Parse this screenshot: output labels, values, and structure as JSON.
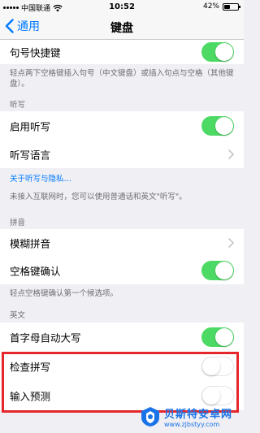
{
  "status_bar": {
    "carrier": "中国联通",
    "time": "10:52",
    "battery": "42%",
    "battery_level": 0.42
  },
  "navbar": {
    "back_label": "通用",
    "title": "键盘"
  },
  "rows": {
    "period_shortcut": {
      "label": "句号快捷键",
      "on": true
    },
    "enable_dictation": {
      "label": "启用听写",
      "on": true
    },
    "dictation_language": {
      "label": "听写语言"
    },
    "fuzzy_pinyin": {
      "label": "模糊拼音"
    },
    "space_confirm": {
      "label": "空格键确认",
      "on": true
    },
    "auto_capitalization": {
      "label": "首字母自动大写",
      "on": true
    },
    "check_spelling": {
      "label": "检查拼写",
      "on": false
    },
    "predictive": {
      "label": "输入预测",
      "on": false
    }
  },
  "notes": {
    "period_shortcut": "轻点两下空格键插入句号（中文键盘）或插入句点与空格（其他键盘）。",
    "dictation_link": "关于听写与隐私…",
    "dictation_info": "未接入互联网时，您可以使用普通话和英文\"听写\"。",
    "space_confirm": "轻点空格键确认第一个候选项。"
  },
  "headers": {
    "dictation": "听写",
    "pinyin": "拼音",
    "english": "英文"
  },
  "watermark": {
    "title": "贝斯特安卓网",
    "url": "www.zjbstyy.com"
  },
  "colors": {
    "accent": "#007aff",
    "toggle_on": "#4cd964",
    "highlight": "#e5262b"
  }
}
